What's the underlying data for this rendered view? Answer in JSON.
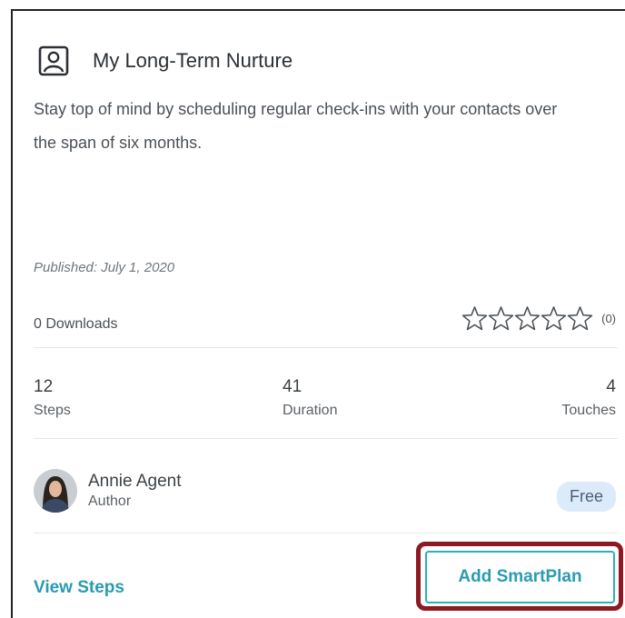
{
  "plan": {
    "title": "My Long-Term Nurture",
    "icon": "contact-card-icon",
    "description": "Stay top of mind by scheduling regular check-ins with your contacts over the span of six months.",
    "published": "Published: July 1, 2020",
    "downloads": "0 Downloads",
    "rating": {
      "value": 0,
      "max": 5,
      "count_label": "(0)"
    }
  },
  "stats": [
    {
      "value": "12",
      "label": "Steps"
    },
    {
      "value": "41",
      "label": "Duration"
    },
    {
      "value": "4",
      "label": "Touches"
    }
  ],
  "author": {
    "name": "Annie Agent",
    "role": "Author",
    "avatar": "avatar-photo"
  },
  "price_badge": "Free",
  "actions": {
    "view_steps": "View Steps",
    "add_smartplan": "Add SmartPlan"
  },
  "colors": {
    "accent": "#2a9bb0",
    "highlight_outline": "#8c1a22",
    "badge_bg": "#dcebfa"
  }
}
